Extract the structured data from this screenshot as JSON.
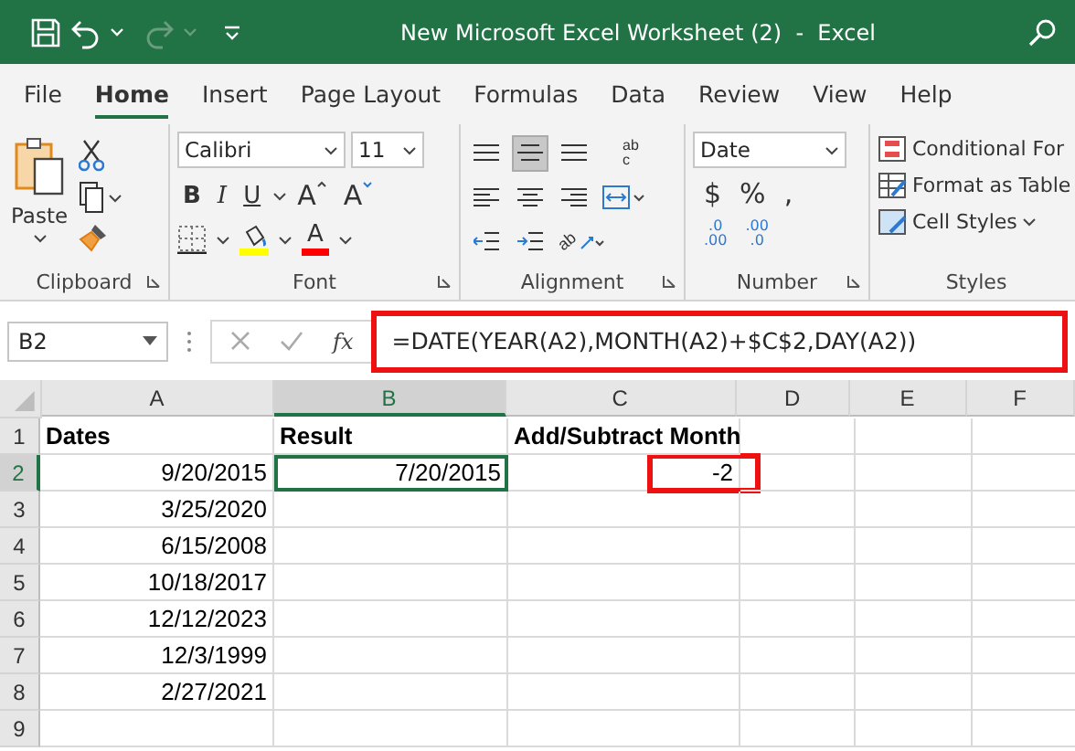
{
  "window": {
    "title": "New Microsoft Excel Worksheet (2)  -  Excel",
    "redo_disabled": true
  },
  "tabs": [
    {
      "label": "File",
      "selected": false
    },
    {
      "label": "Home",
      "selected": true
    },
    {
      "label": "Insert",
      "selected": false
    },
    {
      "label": "Page Layout",
      "selected": false
    },
    {
      "label": "Formulas",
      "selected": false
    },
    {
      "label": "Data",
      "selected": false
    },
    {
      "label": "Review",
      "selected": false
    },
    {
      "label": "View",
      "selected": false
    },
    {
      "label": "Help",
      "selected": false
    }
  ],
  "ribbon": {
    "clipboard": {
      "label": "Clipboard",
      "paste": "Paste"
    },
    "font": {
      "label": "Font",
      "family": "Calibri",
      "size": "11",
      "styles": [
        "B",
        "I",
        "U"
      ],
      "grow": "A",
      "shrink": "A",
      "font_color": "A"
    },
    "alignment": {
      "label": "Alignment",
      "wrap_glyph": [
        "ab",
        "c"
      ],
      "orientation_glyph": "ab",
      "buttons": [
        {
          "kind": "top",
          "selected": false
        },
        {
          "kind": "middle",
          "selected": true
        },
        {
          "kind": "bottom",
          "selected": false
        },
        {
          "kind": "wrap",
          "selected": false
        },
        {
          "kind": "left",
          "selected": false
        },
        {
          "kind": "center",
          "selected": false
        },
        {
          "kind": "right",
          "selected": false
        },
        {
          "kind": "merge",
          "selected": false
        },
        {
          "kind": "outdent",
          "selected": false
        },
        {
          "kind": "indent",
          "selected": false
        },
        {
          "kind": "orientation",
          "selected": false
        }
      ]
    },
    "number": {
      "label": "Number",
      "format": "Date",
      "symbols": [
        "$",
        "%",
        ","
      ],
      "decimals": [
        {
          "top": ".0",
          "bottom": ".00"
        },
        {
          "top": ".00",
          "bottom": ".0"
        }
      ]
    },
    "styles": {
      "label": "Styles",
      "items": [
        {
          "label": "Conditional For",
          "kind": "conditional"
        },
        {
          "label": "Format as Table",
          "kind": "table"
        },
        {
          "label": "Cell Styles",
          "kind": "cell"
        }
      ]
    }
  },
  "formula_bar": {
    "name_box": "B2",
    "fx": "fx",
    "formula": "=DATE(YEAR(A2),MONTH(A2)+$C$2,DAY(A2))",
    "highlighted": true
  },
  "sheet": {
    "columns": [
      {
        "label": "A",
        "selected": false
      },
      {
        "label": "B",
        "selected": true
      },
      {
        "label": "C",
        "selected": false
      },
      {
        "label": "D",
        "selected": false
      },
      {
        "label": "E",
        "selected": false
      },
      {
        "label": "F",
        "selected": false
      }
    ],
    "rows": [
      {
        "label": "1",
        "selected": false,
        "cells": [
          {
            "text": "Dates",
            "kind": "heading",
            "selected": false,
            "highlighted": false
          },
          {
            "text": "Result",
            "kind": "heading",
            "selected": false,
            "highlighted": false
          },
          {
            "text": "Add/Subtract Month",
            "kind": "heading",
            "selected": false,
            "highlighted": false
          }
        ]
      },
      {
        "label": "2",
        "selected": true,
        "cells": [
          {
            "text": "9/20/2015",
            "kind": "number",
            "selected": false,
            "highlighted": false
          },
          {
            "text": "7/20/2015",
            "kind": "number",
            "selected": true,
            "highlighted": false
          },
          {
            "text": "-2",
            "kind": "number",
            "selected": false,
            "highlighted": true
          }
        ]
      },
      {
        "label": "3",
        "selected": false,
        "cells": [
          {
            "text": "3/25/2020",
            "kind": "number",
            "selected": false,
            "highlighted": false
          }
        ]
      },
      {
        "label": "4",
        "selected": false,
        "cells": [
          {
            "text": "6/15/2008",
            "kind": "number",
            "selected": false,
            "highlighted": false
          }
        ]
      },
      {
        "label": "5",
        "selected": false,
        "cells": [
          {
            "text": "10/18/2017",
            "kind": "number",
            "selected": false,
            "highlighted": false
          }
        ]
      },
      {
        "label": "6",
        "selected": false,
        "cells": [
          {
            "text": "12/12/2023",
            "kind": "number",
            "selected": false,
            "highlighted": false
          }
        ]
      },
      {
        "label": "7",
        "selected": false,
        "cells": [
          {
            "text": "12/3/1999",
            "kind": "number",
            "selected": false,
            "highlighted": false
          }
        ]
      },
      {
        "label": "8",
        "selected": false,
        "cells": [
          {
            "text": "2/27/2021",
            "kind": "number",
            "selected": false,
            "highlighted": false
          }
        ]
      },
      {
        "label": "9",
        "selected": false,
        "cells": []
      }
    ]
  }
}
